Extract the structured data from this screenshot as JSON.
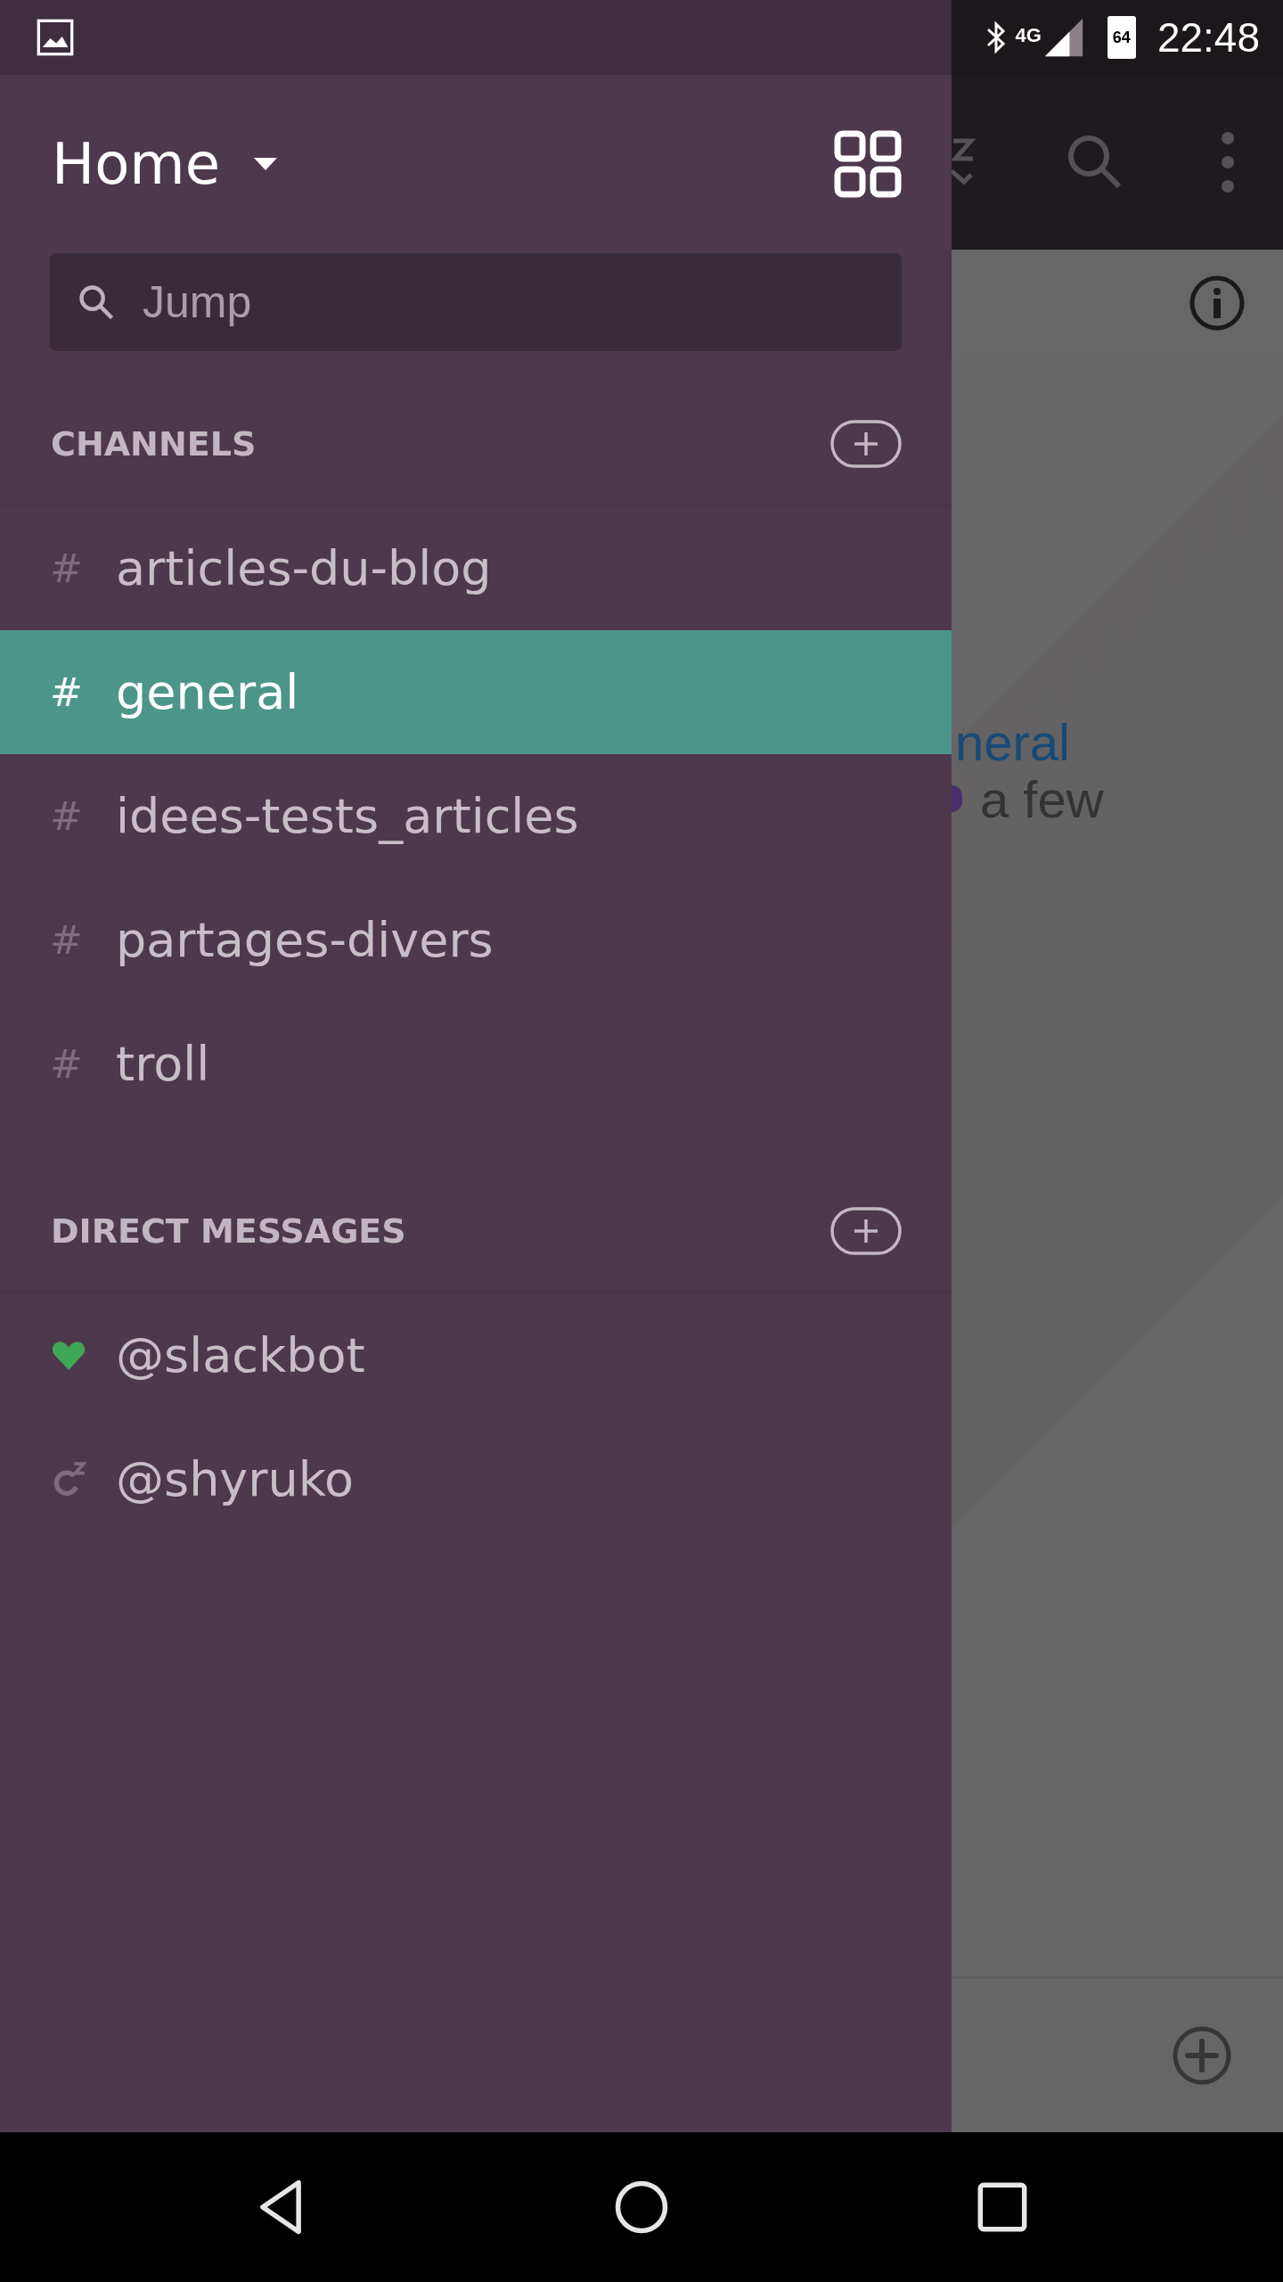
{
  "status_bar": {
    "network": "4G",
    "battery": "64",
    "time": "22:48"
  },
  "drawer": {
    "title": "Home",
    "search": {
      "placeholder": "Jump"
    },
    "sections": [
      {
        "heading": "CHANNELS",
        "items": [
          {
            "kind": "channel",
            "icon": "#",
            "label": "articles-du-blog",
            "selected": false
          },
          {
            "kind": "channel",
            "icon": "#",
            "label": "general",
            "selected": true
          },
          {
            "kind": "channel",
            "icon": "#",
            "label": "idees-tests_articles",
            "selected": false
          },
          {
            "kind": "channel",
            "icon": "#",
            "label": "partages-divers",
            "selected": false
          },
          {
            "kind": "channel",
            "icon": "#",
            "label": "troll",
            "selected": false
          }
        ]
      },
      {
        "heading": "DIRECT MESSAGES",
        "items": [
          {
            "kind": "active",
            "label": "@slackbot",
            "selected": false
          },
          {
            "kind": "away",
            "label": "@shyruko",
            "selected": false
          }
        ]
      }
    ]
  },
  "conversation": {
    "lines": [
      {
        "kind": "link",
        "text": "neral"
      },
      {
        "kind": "plain",
        "text": "a few"
      }
    ]
  }
}
